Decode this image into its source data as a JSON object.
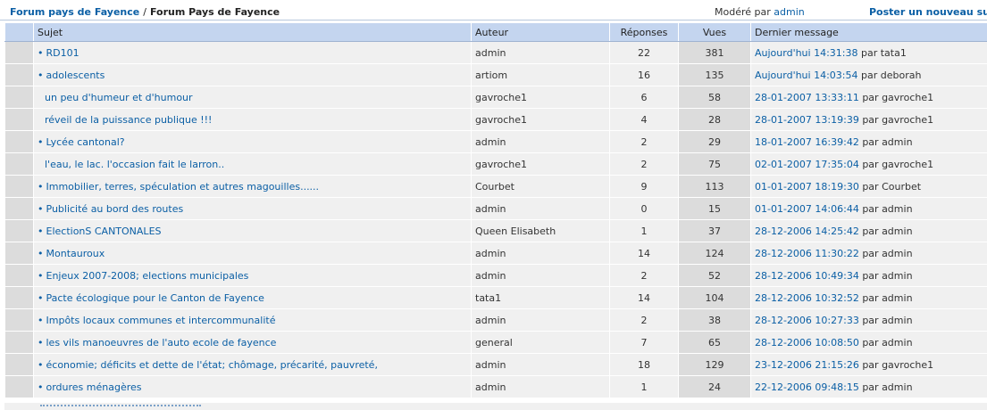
{
  "breadcrumb": {
    "root": "Forum pays de Fayence",
    "separator": "/",
    "current": "Forum Pays de Fayence"
  },
  "moderation": {
    "label": "Modéré par",
    "moderator": "admin"
  },
  "new_topic_label": "Poster un nouveau suje",
  "columns": {
    "subject": "Sujet",
    "author": "Auteur",
    "replies": "Réponses",
    "views": "Vues",
    "last": "Dernier message"
  },
  "topics": [
    {
      "bullet": "•",
      "subject": "RD101",
      "author": "admin",
      "replies": "22",
      "views": "381",
      "last_date": "Aujourd'hui 14:31:38",
      "last_by": "par tata1"
    },
    {
      "bullet": "•",
      "subject": "adolescents",
      "author": "artiom",
      "replies": "16",
      "views": "135",
      "last_date": "Aujourd'hui 14:03:54",
      "last_by": "par deborah"
    },
    {
      "bullet": "",
      "subject": "un peu d'humeur et d'humour",
      "author": "gavroche1",
      "replies": "6",
      "views": "58",
      "last_date": "28-01-2007 13:33:11",
      "last_by": "par gavroche1"
    },
    {
      "bullet": "",
      "subject": "réveil de la puissance publique !!!",
      "author": "gavroche1",
      "replies": "4",
      "views": "28",
      "last_date": "28-01-2007 13:19:39",
      "last_by": "par gavroche1"
    },
    {
      "bullet": "•",
      "subject": "Lycée cantonal?",
      "author": "admin",
      "replies": "2",
      "views": "29",
      "last_date": "18-01-2007 16:39:42",
      "last_by": "par admin"
    },
    {
      "bullet": "",
      "subject": "l'eau, le lac. l'occasion fait le larron..",
      "author": "gavroche1",
      "replies": "2",
      "views": "75",
      "last_date": "02-01-2007 17:35:04",
      "last_by": "par gavroche1"
    },
    {
      "bullet": "•",
      "subject": "Immobilier, terres, spéculation et autres magouilles......",
      "author": "Courbet",
      "replies": "9",
      "views": "113",
      "last_date": "01-01-2007 18:19:30",
      "last_by": "par Courbet"
    },
    {
      "bullet": "•",
      "subject": "Publicité au bord des routes",
      "author": "admin",
      "replies": "0",
      "views": "15",
      "last_date": "01-01-2007 14:06:44",
      "last_by": "par admin"
    },
    {
      "bullet": "•",
      "subject": "ElectionS CANTONALES",
      "author": "Queen Elisabeth",
      "replies": "1",
      "views": "37",
      "last_date": "28-12-2006 14:25:42",
      "last_by": "par admin"
    },
    {
      "bullet": "•",
      "subject": "Montauroux",
      "author": "admin",
      "replies": "14",
      "views": "124",
      "last_date": "28-12-2006 11:30:22",
      "last_by": "par admin"
    },
    {
      "bullet": "•",
      "subject": "Enjeux 2007-2008; elections municipales",
      "author": "admin",
      "replies": "2",
      "views": "52",
      "last_date": "28-12-2006 10:49:34",
      "last_by": "par admin"
    },
    {
      "bullet": "•",
      "subject": "Pacte écologique pour le Canton de Fayence",
      "author": "tata1",
      "replies": "14",
      "views": "104",
      "last_date": "28-12-2006 10:32:52",
      "last_by": "par admin"
    },
    {
      "bullet": "•",
      "subject": "Impôts locaux communes et intercommunalité",
      "author": "admin",
      "replies": "2",
      "views": "38",
      "last_date": "28-12-2006 10:27:33",
      "last_by": "par admin"
    },
    {
      "bullet": "•",
      "subject": "les vils manoeuvres de l'auto ecole de fayence",
      "author": "general",
      "replies": "7",
      "views": "65",
      "last_date": "28-12-2006 10:08:50",
      "last_by": "par admin"
    },
    {
      "bullet": "•",
      "subject": "économie; déficits et dette de l'état; chômage, précarité, pauvreté,",
      "author": "admin",
      "replies": "18",
      "views": "129",
      "last_date": "23-12-2006 21:15:26",
      "last_by": "par gavroche1"
    },
    {
      "bullet": "•",
      "subject": "ordures ménagères",
      "author": "admin",
      "replies": "1",
      "views": "24",
      "last_date": "22-12-2006 09:48:15",
      "last_by": "par admin"
    }
  ],
  "colors": {
    "header_bg": "#c4d5ef",
    "row_light": "#f0f0f0",
    "row_dark": "#dcdcdc",
    "link": "#0b5fa5"
  }
}
